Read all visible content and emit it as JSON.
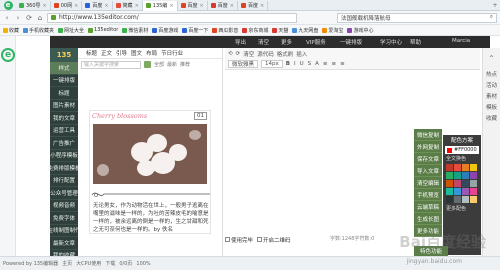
{
  "tabs": [
    {
      "label": "360导",
      "color": "#3bb34a"
    },
    {
      "label": "00网",
      "color": "#e0431f"
    },
    {
      "label": "百度",
      "color": "#2b62d6"
    },
    {
      "label": "简藏",
      "color": "#e64c3b"
    },
    {
      "label": "135编",
      "color": "#5aa02c",
      "active": true
    },
    {
      "label": "百度",
      "color": "#e0431f"
    },
    {
      "label": "百度",
      "color": "#d9382c"
    },
    {
      "label": "百度",
      "color": "#e0431f"
    }
  ],
  "addr": {
    "url": "http://www.135editor.com/",
    "search": "法国舰载机降落航母"
  },
  "bookmarks": [
    {
      "label": "收藏",
      "color": "#f0b400"
    },
    {
      "label": "手机收藏夹",
      "color": "#4a90d9"
    },
    {
      "label": "网址大全",
      "color": "#3bb34a"
    },
    {
      "label": "135editor",
      "color": "#5aa02c"
    },
    {
      "label": "微信素材",
      "color": "#3bb34a"
    },
    {
      "label": "百度游戏",
      "color": "#2b62d6"
    },
    {
      "label": "百度一下",
      "color": "#2b62d6"
    },
    {
      "label": "西瓜影音",
      "color": "#e0431f"
    },
    {
      "label": "京东商城",
      "color": "#d9382c"
    },
    {
      "label": "天猫",
      "color": "#d9382c"
    },
    {
      "label": "九天网盘",
      "color": "#4a90d9"
    },
    {
      "label": "爱淘宝",
      "color": "#f08a00"
    },
    {
      "label": "游戏中心",
      "color": "#8e44ad"
    }
  ],
  "header_tools": [
    "导出",
    "清空",
    "更多",
    "VIP服务",
    "一键排版",
    "学习中心",
    "帮助",
    "Marcia"
  ],
  "categories": [
    "样式",
    "一键排版",
    "标题",
    "图片素材",
    "我的文章",
    "运营工具",
    "广告推广",
    "小程序模板",
    "免费排版模板",
    "排行配置",
    "公众号管理",
    "视频音频",
    "免费字体",
    "在线制图制作",
    "最新文章",
    "我的收藏",
    "一键排版"
  ],
  "tpl_menu": [
    "标题",
    "正文",
    "引导",
    "图文",
    "布局",
    "节日行业"
  ],
  "tpl_search": "输入关键字搜索",
  "tpl_tags": [
    "全部",
    "最新",
    "推荐"
  ],
  "card": {
    "title": "Cherry blossoms",
    "number": "01",
    "text": "无论男女，作为动物活在世上，一般男子逃离在嘴里的滋味是一样的，为吐的苦辣皮毛的喻意是一样的，被余远离的倒是一样的，生之甘甜和死之无可奈何也是一样的。by 佚名"
  },
  "toolbar": {
    "row1": [
      "⟲",
      "⟳",
      "清空",
      "源代码",
      "格式刷",
      "插入"
    ],
    "font_label": "微软雅黑",
    "size_label": "14px",
    "row2": [
      "B",
      "I",
      "U",
      "S",
      "A",
      "≡",
      "≡",
      "≡"
    ]
  },
  "actions": [
    "微信复制",
    "外网复制",
    "保存文章",
    "导入文章",
    "清空编辑",
    "手机预览",
    "云端草稿",
    "生成长图",
    "更多功能"
  ],
  "palette": {
    "title": "配色方案",
    "selected": "#FF0000",
    "fill_label": "全文换色",
    "swatches": [
      "#c0392b",
      "#e74c3c",
      "#e67e22",
      "#f1c40f",
      "#27ae60",
      "#16a085",
      "#2980b9",
      "#8e44ad",
      "#d35400",
      "#c44569",
      "#34495e",
      "#95a5a6",
      "#1abc9c",
      "#3498db",
      "#9b59b6",
      "#e84393",
      "#2d3436",
      "#636e72",
      "#b2bec3",
      "#fdcb6e"
    ],
    "more_label": "更多配色"
  },
  "special_btn": "特色功能",
  "rightrail": [
    "热点",
    "活动",
    "素材",
    "模板",
    "收藏"
  ],
  "edbottom": {
    "check1": "使用完毕",
    "check2": "开启二维码"
  },
  "wordcount": "字数:1248字符数:0",
  "status": [
    "Powered by 135编辑器",
    "主页",
    "大CPU使用",
    "下载",
    "0/0页",
    "100%"
  ],
  "watermark": "Bai百度经验",
  "jingyan": "jingyan.baidu.com",
  "header_badge": "VIP"
}
